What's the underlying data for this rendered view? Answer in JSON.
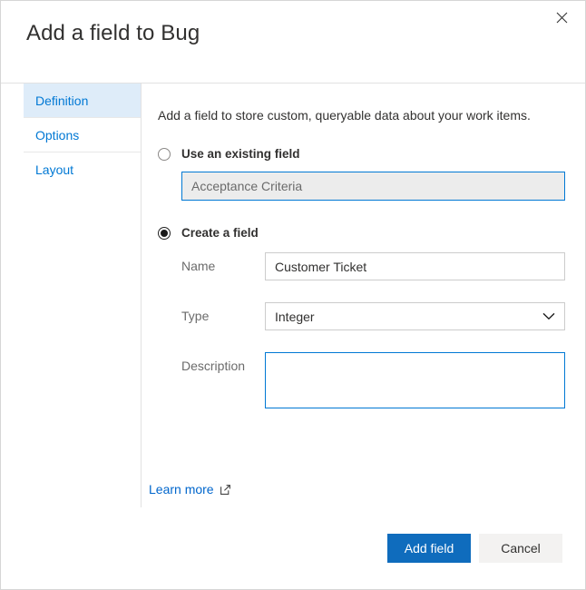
{
  "dialog": {
    "title": "Add a field to Bug",
    "close_icon": "close-icon"
  },
  "pivot": {
    "items": [
      {
        "label": "Definition",
        "selected": true
      },
      {
        "label": "Options",
        "selected": false
      },
      {
        "label": "Layout",
        "selected": false
      }
    ]
  },
  "content": {
    "intro": "Add a field to store custom, queryable data about your work items.",
    "existing_field": {
      "radio_label": "Use an existing field",
      "selected": false,
      "value": "Acceptance Criteria"
    },
    "create_field": {
      "radio_label": "Create a field",
      "selected": true,
      "name": {
        "label": "Name",
        "value": "Customer Ticket",
        "placeholder": ""
      },
      "type": {
        "label": "Type",
        "value": "Integer",
        "chevron_icon": "chevron-down-icon"
      },
      "description": {
        "label": "Description",
        "value": "",
        "placeholder": ""
      }
    },
    "learn_more": {
      "label": "Learn more",
      "icon": "external-link-icon"
    }
  },
  "footer": {
    "primary_label": "Add field",
    "secondary_label": "Cancel"
  },
  "colors": {
    "accent": "#0078d4",
    "primary_button": "#0f6cbd",
    "selected_tab_bg": "#deecf9",
    "link": "#0066cc",
    "disabled_input_bg": "#ececec"
  }
}
